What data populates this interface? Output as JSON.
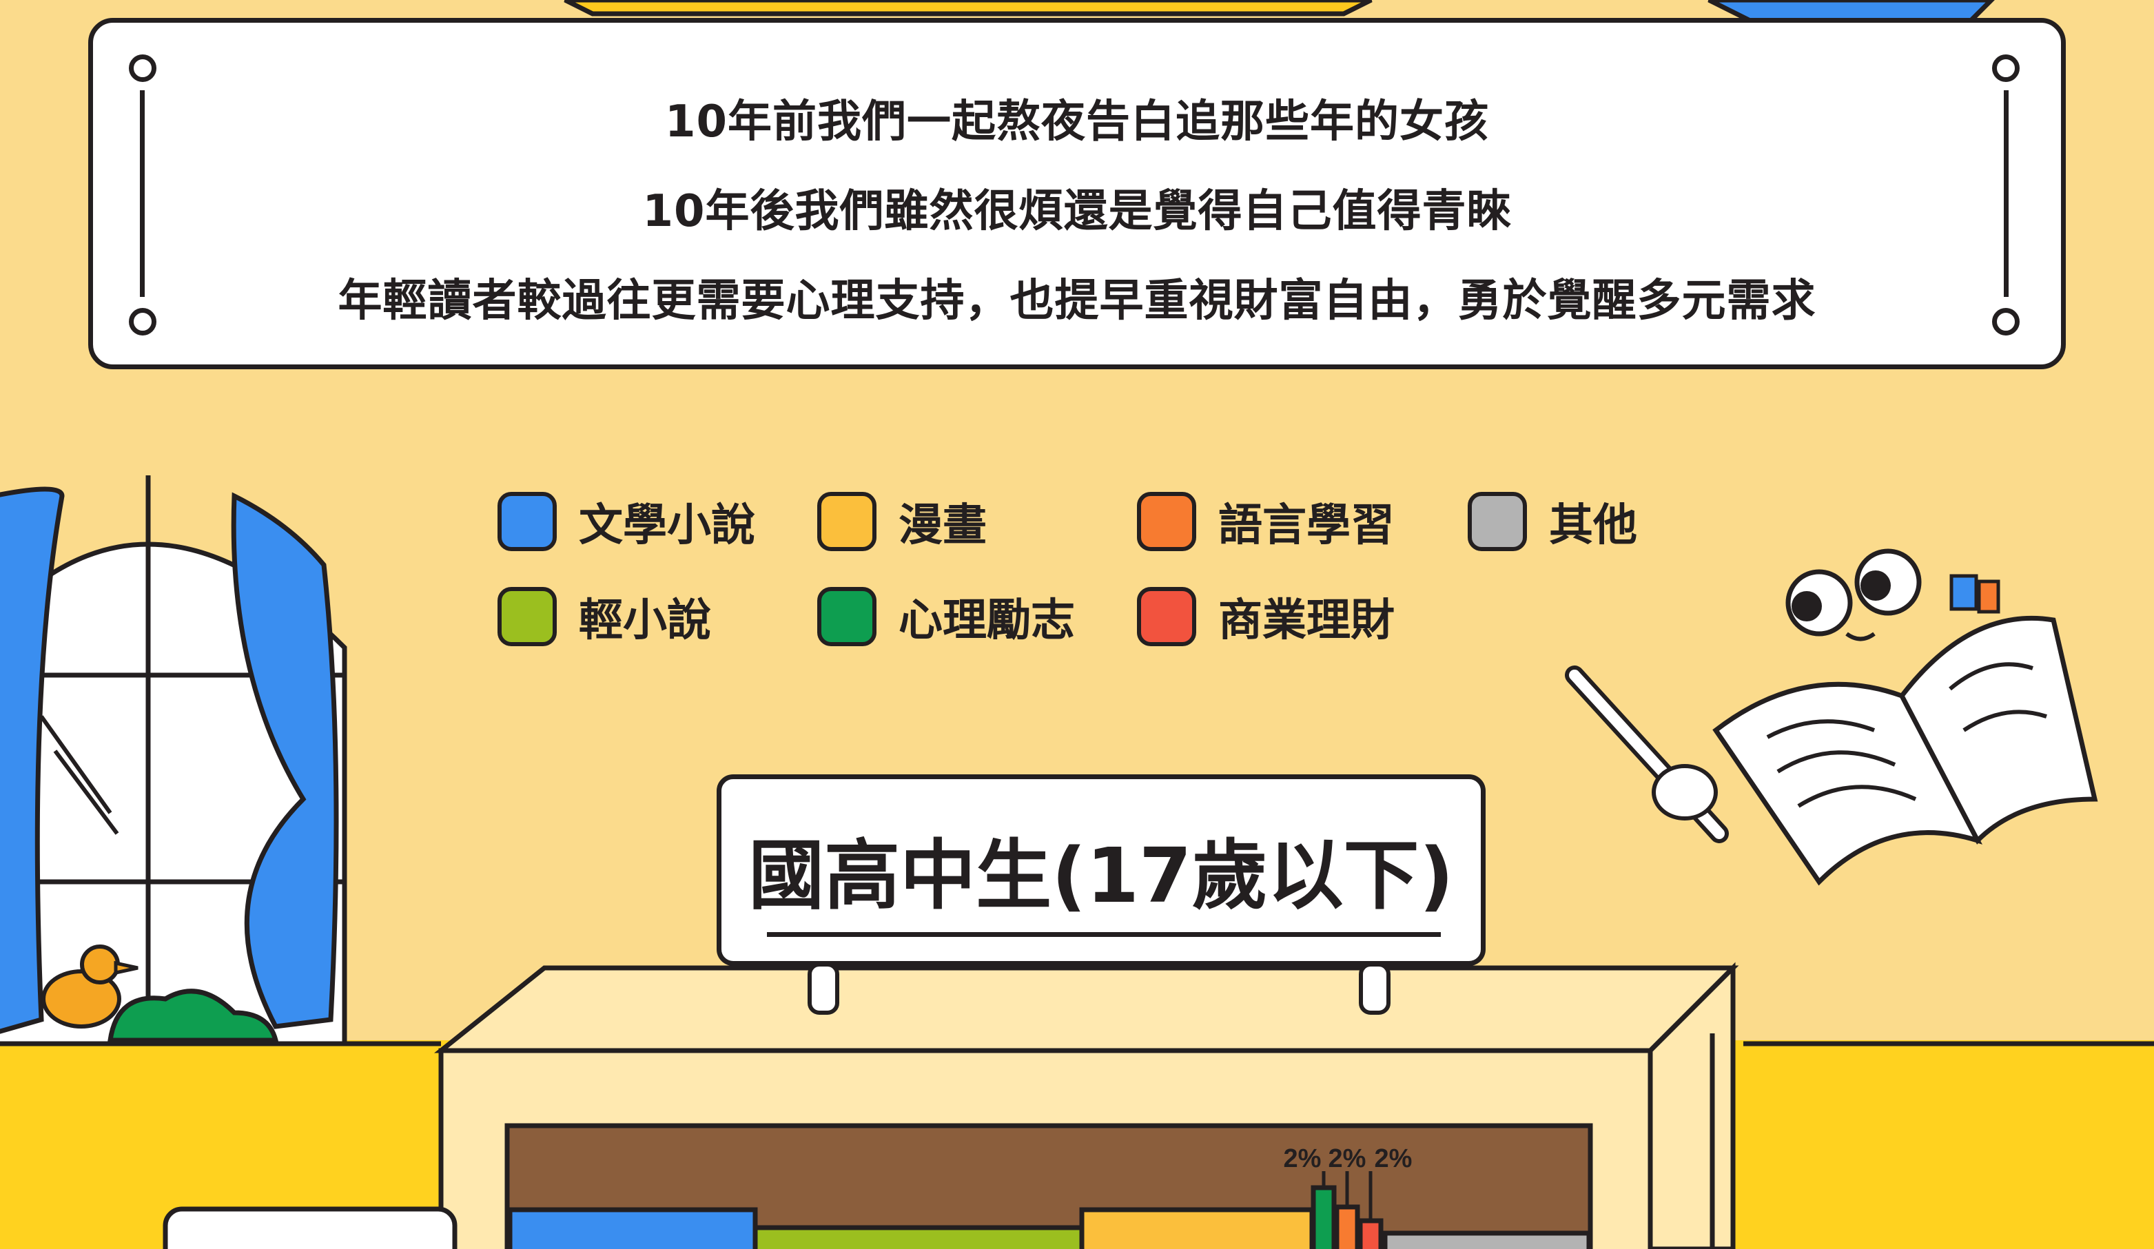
{
  "banner": {
    "line1": "10年前我們一起熬夜告白追那些年的女孩",
    "line2": "10年後我們雖然很煩還是覺得自己值得青睞",
    "line3": "年輕讀者較過往更需要心理支持，也提早重視財富自由，勇於覺醒多元需求"
  },
  "legend": [
    {
      "label": "文學小說",
      "color": "#3A8EF0"
    },
    {
      "label": "漫畫",
      "color": "#FBBF3C"
    },
    {
      "label": "語言學習",
      "color": "#F77B30"
    },
    {
      "label": "其他",
      "color": "#B3B3B3"
    },
    {
      "label": "輕小說",
      "color": "#9BBF1F"
    },
    {
      "label": "心理勵志",
      "color": "#0E9E50"
    },
    {
      "label": "商業理財",
      "color": "#F2533E"
    }
  ],
  "sign": {
    "title": "國高中生(17歲以下)"
  },
  "chart_data": {
    "type": "bar",
    "title": "國高中生(17歲以下)",
    "categories": [
      "文學小說",
      "輕小說",
      "漫畫",
      "心理勵志",
      "語言學習",
      "商業理財",
      "其他"
    ],
    "values": [
      null,
      null,
      null,
      2,
      2,
      2,
      null
    ],
    "value_labels": [
      "",
      "",
      "",
      "2%",
      "2%",
      "2%",
      ""
    ],
    "colors": [
      "#3A8EF0",
      "#9BBF1F",
      "#FBBF3C",
      "#0E9E50",
      "#F77B30",
      "#F2533E",
      "#B3B3B3"
    ]
  }
}
